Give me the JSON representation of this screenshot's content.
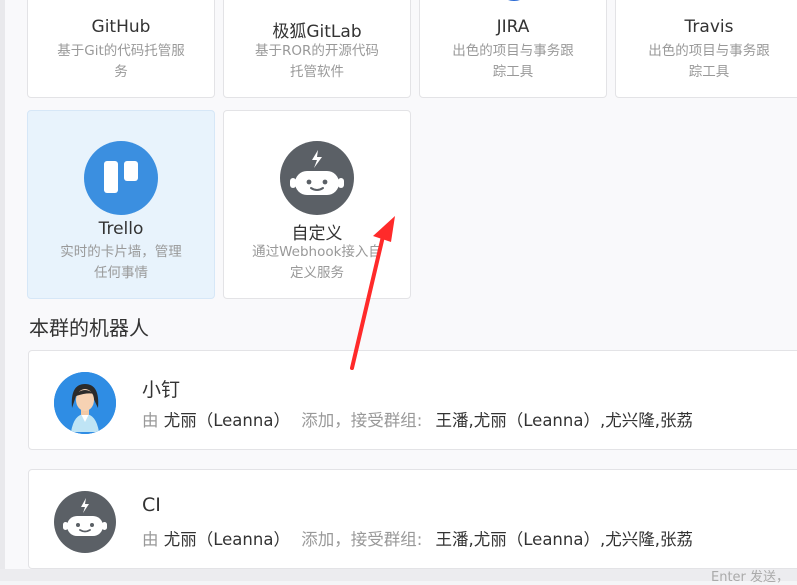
{
  "integrations": [
    {
      "name": "GitHub",
      "desc1": "基于Git的代码托管服",
      "desc2": "务"
    },
    {
      "name": "极狐GitLab",
      "desc1": "基于ROR的开源代码",
      "desc2": "托管软件"
    },
    {
      "name": "JIRA",
      "desc1": "出色的项目与事务跟",
      "desc2": "踪工具"
    },
    {
      "name": "Travis",
      "desc1": "出色的项目与事务跟",
      "desc2": "踪工具"
    },
    {
      "name": "Trello",
      "desc1": "实时的卡片墙，管理",
      "desc2": "任何事情"
    },
    {
      "name": "自定义",
      "desc1": "通过Webhook接入自",
      "desc2": "定义服务"
    }
  ],
  "section": {
    "title": "本群的机器人"
  },
  "robots": [
    {
      "name": "小钉",
      "by_label": "由",
      "creator": "尤丽（Leanna）",
      "added_label": "添加，接受群组:",
      "groups": "王潘,尤丽（Leanna）,尤兴隆,张荔"
    },
    {
      "name": "CI",
      "by_label": "由",
      "creator": "尤丽（Leanna）",
      "added_label": "添加，接受群组:",
      "groups": "王潘,尤丽（Leanna）,尤兴隆,张荔"
    }
  ],
  "footer": {
    "hint": "Enter 发送，"
  },
  "colors": {
    "trello": "#3b8fe0",
    "robot_gray": "#5b6066",
    "selected_bg": "#e8f3fc",
    "arrow": "#ff2a2a"
  }
}
